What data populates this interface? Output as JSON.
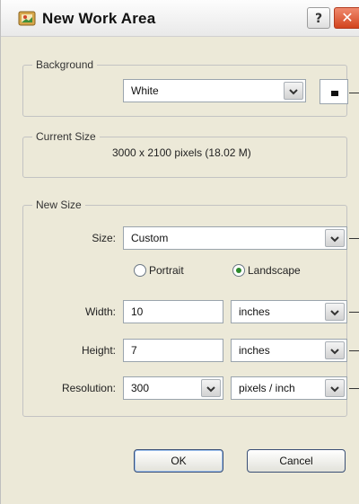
{
  "window": {
    "title": "New Work Area",
    "help_glyph": "?",
    "close_glyph": "✕"
  },
  "background": {
    "group_label": "Background",
    "value": "White",
    "swatch_color": "#ffffff"
  },
  "current_size": {
    "group_label": "Current Size",
    "text": "3000 x 2100 pixels (18.02 M)"
  },
  "new_size": {
    "group_label": "New Size",
    "size_label": "Size:",
    "size_value": "Custom",
    "orientation": {
      "portrait_label": "Portrait",
      "landscape_label": "Landscape",
      "selected": "landscape"
    },
    "width_label": "Width:",
    "width_value": "10",
    "width_unit": "inches",
    "height_label": "Height:",
    "height_value": "7",
    "height_unit": "inches",
    "resolution_label": "Resolution:",
    "resolution_value": "300",
    "resolution_unit": "pixels / inch"
  },
  "buttons": {
    "ok": "OK",
    "cancel": "Cancel"
  },
  "icons": {
    "app": "new-work-area-icon",
    "dropdown": "chevron-down-icon"
  },
  "colors": {
    "dialog_bg": "#ece9d8",
    "close_red": "#d2441e",
    "radio_selected": "#2c8a2c"
  }
}
